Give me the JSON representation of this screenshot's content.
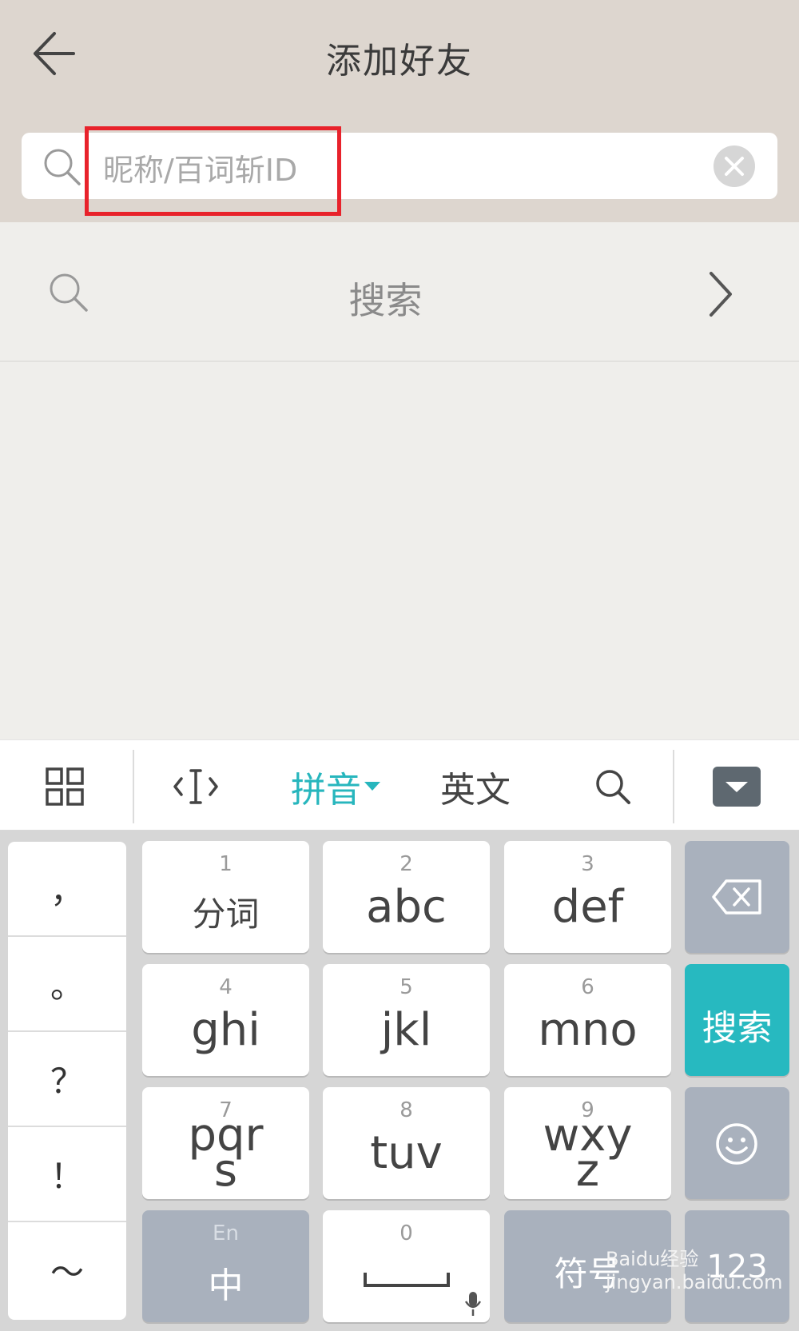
{
  "header": {
    "title": "添加好友",
    "search_placeholder": "昵称/百词斩ID"
  },
  "search_row": {
    "label": "搜索"
  },
  "ime_toolbar": {
    "items": [
      "grid-icon",
      "cursor-icon",
      "拼音",
      "英文",
      "search-icon",
      "hide-keyboard-icon"
    ],
    "pinyin_label": "拼音",
    "english_label": "英文",
    "active_color": "#27b6bd"
  },
  "keyboard": {
    "punctuation": [
      "，",
      "。",
      "？",
      "！",
      "～"
    ],
    "keys": {
      "k1": {
        "num": "1",
        "label": "分词"
      },
      "k2": {
        "num": "2",
        "label": "abc"
      },
      "k3": {
        "num": "3",
        "label": "def"
      },
      "k4": {
        "num": "4",
        "label": "ghi"
      },
      "k5": {
        "num": "5",
        "label": "jkl"
      },
      "k6": {
        "num": "6",
        "label": "mno"
      },
      "k7": {
        "num": "7",
        "label": "pqr",
        "label2": "s"
      },
      "k8": {
        "num": "8",
        "label": "tuv"
      },
      "k9": {
        "num": "9",
        "label": "wxy",
        "label2": "z"
      },
      "k0": {
        "num": "0"
      },
      "lang": {
        "top": "En",
        "label": "中"
      },
      "symbol": "符号",
      "num_switch": "123",
      "search": "搜索"
    },
    "accent_color": "#27b9c0"
  },
  "watermark": "Baidu经验 jingyan.baidu.com"
}
